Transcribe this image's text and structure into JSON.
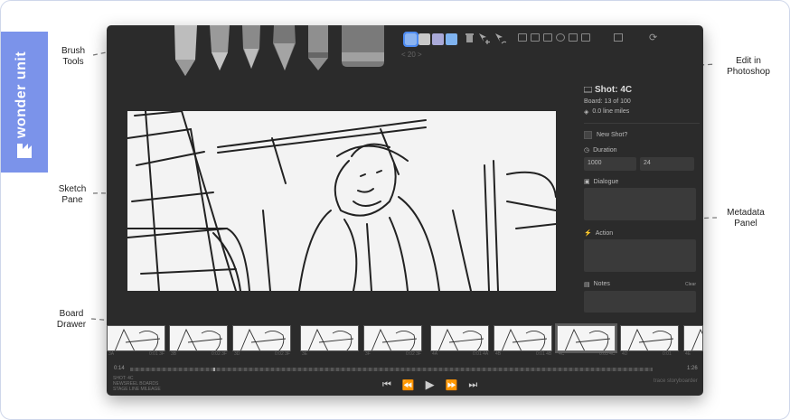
{
  "brand": {
    "name": "wonder unit",
    "color": "#7b93ea"
  },
  "labels": {
    "brush_tools": "Brush\nTools",
    "sketch_pane": "Sketch\nPane",
    "board_drawer": "Board\nDrawer",
    "edit_in_photoshop": "Edit in\nPhotoshop",
    "metadata_panel": "Metadata\nPanel"
  },
  "toolbar": {
    "swatches": [
      "#8cb4f0",
      "#c8c8c8",
      "#a9a9d8",
      "#7fb3f0"
    ],
    "page_indicator": "< 20 >",
    "icons": [
      "trash-icon",
      "cursor-plus-icon",
      "cursor-pen-icon",
      "grid-icon",
      "layout-icon",
      "layers-icon",
      "stack-icon",
      "film-icon",
      "photoshop-icon",
      "refresh-icon"
    ]
  },
  "metadata": {
    "shot_title": "Shot: 4C",
    "board_info": "Board: 13 of 100",
    "line_miles": "0.0 line miles",
    "new_shot_label": "New Shot?",
    "duration_label": "Duration",
    "duration_ms": "1000",
    "duration_frames": "24",
    "dialogue_label": "Dialogue",
    "action_label": "Action",
    "notes_label": "Notes",
    "clear_label": "Clear"
  },
  "drawer": {
    "thumbnails": [
      {
        "label": "3A",
        "dur": "0:01 3F"
      },
      {
        "label": "3B",
        "dur": "0:02 3F"
      },
      {
        "label": "3D",
        "dur": "0:02 3F"
      },
      {
        "label": "3E",
        "dur": ""
      },
      {
        "label": "3F",
        "dur": "0:02 3F"
      },
      {
        "label": "4A",
        "dur": "0:01 4A"
      },
      {
        "label": "4B",
        "dur": "0:01 4B"
      },
      {
        "label": "4C",
        "dur": "0:03 4C"
      },
      {
        "label": "4D",
        "dur": "0:01"
      },
      {
        "label": "4E",
        "dur": ""
      }
    ]
  },
  "timeline": {
    "current_time": "0:14",
    "total_time": "1:26",
    "bottom_text": "SHOT: 4C\nNEWSREEL BOARDS\nSTAGE LINE MILEAGE",
    "brand_tag": "trace storyboarder"
  }
}
